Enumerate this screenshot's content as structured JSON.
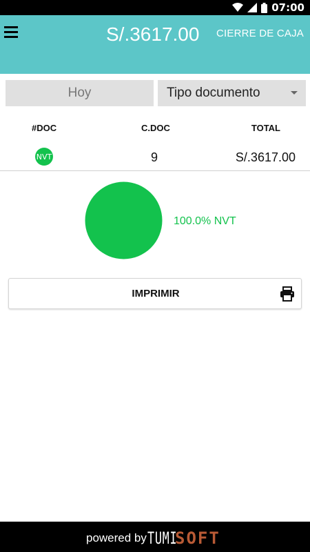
{
  "status_bar": {
    "time": "07:00",
    "icons": [
      "wifi-icon",
      "signal-icon",
      "battery-icon"
    ]
  },
  "app_bar": {
    "menu_icon": "hamburger-menu-icon",
    "total_amount": "S/.3617.00",
    "cierre_label": "CIERRE DE CAJA",
    "background_color": "#5cc6c8"
  },
  "filters": {
    "date_label": "Hoy",
    "doc_type_label": "Tipo documento"
  },
  "table": {
    "headers": [
      "#DOC",
      "C.DOC",
      "TOTAL"
    ],
    "rows": [
      {
        "badge": "NVT",
        "count": "9",
        "total": "S/.3617.00"
      }
    ]
  },
  "chart_data": {
    "type": "pie",
    "slices": [
      {
        "label": "NVT",
        "percent": 100.0,
        "color": "#13c24d"
      }
    ],
    "legend": "100.0% NVT"
  },
  "print_button": {
    "label": "IMPRIMIR",
    "icon": "printer-icon"
  },
  "footer": {
    "powered_by": "powered by",
    "brand_part1": "TUMI",
    "brand_part2": "SOFT"
  }
}
